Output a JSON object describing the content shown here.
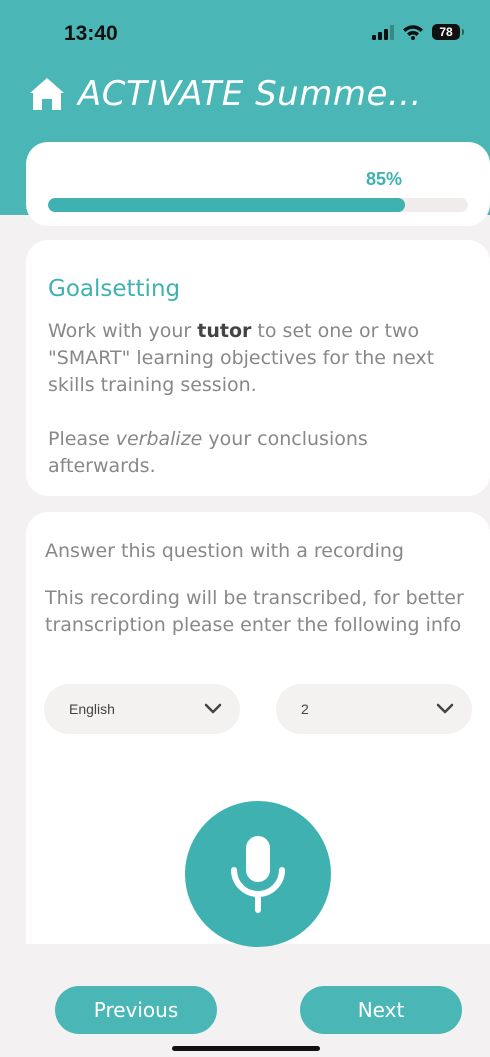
{
  "status_bar": {
    "time": "13:40",
    "battery": "78"
  },
  "header": {
    "title": "ACTIVATE Summe...",
    "home_icon": "home-icon"
  },
  "progress": {
    "label": "85%",
    "value": 0.85
  },
  "goal": {
    "title": "Goalsetting",
    "line1_before": "Work with your ",
    "line1_bold": "tutor",
    "line1_after": " to set one or two \"SMART\" learning objectives for the next skills training session.",
    "line2_before": "Please ",
    "line2_italic": "verbalize",
    "line2_after": " your conclusions afterwards."
  },
  "recording": {
    "question": "Answer this question with a recording",
    "info": "This recording will be transcribed, for better transcription please enter the following info",
    "language_value": "English",
    "count_value": "2",
    "mic_icon": "microphone-icon"
  },
  "navigation": {
    "previous_label": "Previous",
    "next_label": "Next"
  },
  "colors": {
    "accent": "#4bb6b6",
    "accent_dark": "#3fb1b1",
    "background": "#f3f1f1",
    "text_muted": "#888888"
  }
}
